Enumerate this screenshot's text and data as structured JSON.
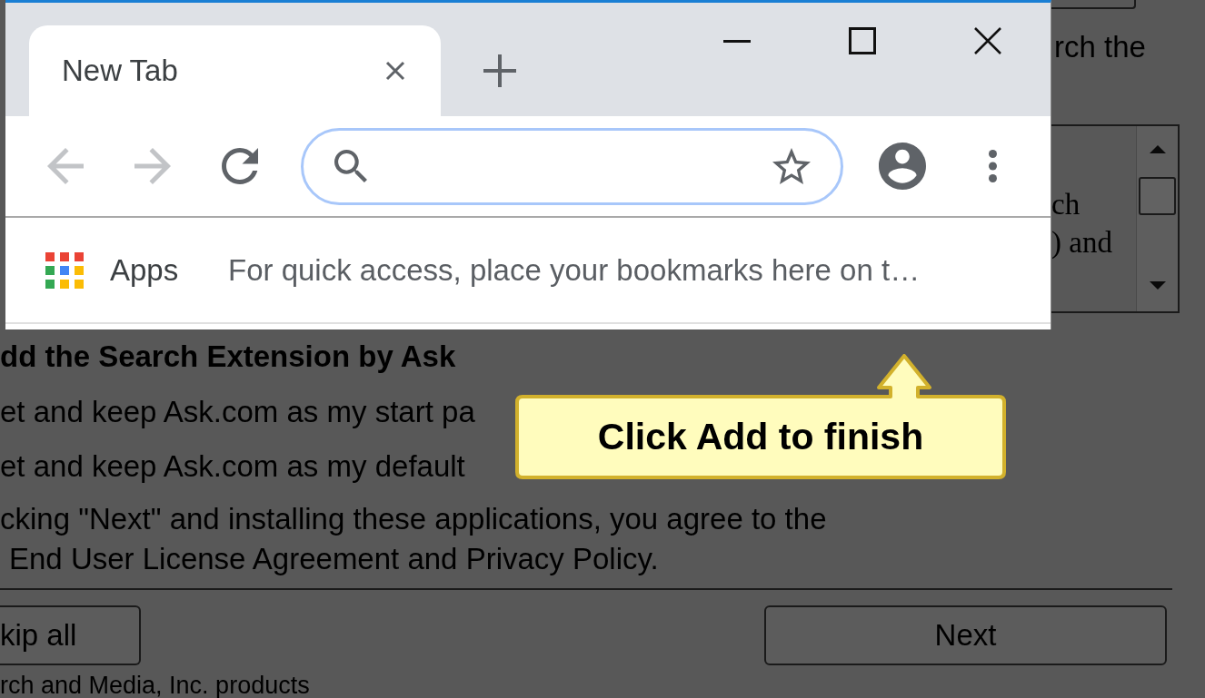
{
  "browser": {
    "tabs": [
      {
        "title": "New Tab",
        "selected": true
      }
    ],
    "nav_buttons": [
      {
        "kind": "back",
        "disabled": true
      },
      {
        "kind": "forward",
        "disabled": true
      },
      {
        "kind": "reload",
        "disabled": false
      }
    ],
    "address_bar": {
      "focused": true
    },
    "bookmarks_bar": {
      "apps_label": "Apps",
      "hint": "For quick access, place your bookmarks here on t…"
    }
  },
  "installer": {
    "top_text": "rch the",
    "list_lines": [
      "ch",
      ") and"
    ],
    "heading": "dd the Search Extension by Ask",
    "options": [
      "et and keep Ask.com as my start pa",
      "et and keep Ask.com as my default"
    ],
    "agreement_lines": [
      "cking \"Next\" and installing these applications, you agree to the",
      "End User License Agreement and Privacy Policy."
    ],
    "buttons": [
      {
        "label": "kip all"
      },
      {
        "label": "Next"
      }
    ],
    "footer": "rch and Media, Inc. products"
  },
  "callout": {
    "text": "Click Add to finish"
  }
}
